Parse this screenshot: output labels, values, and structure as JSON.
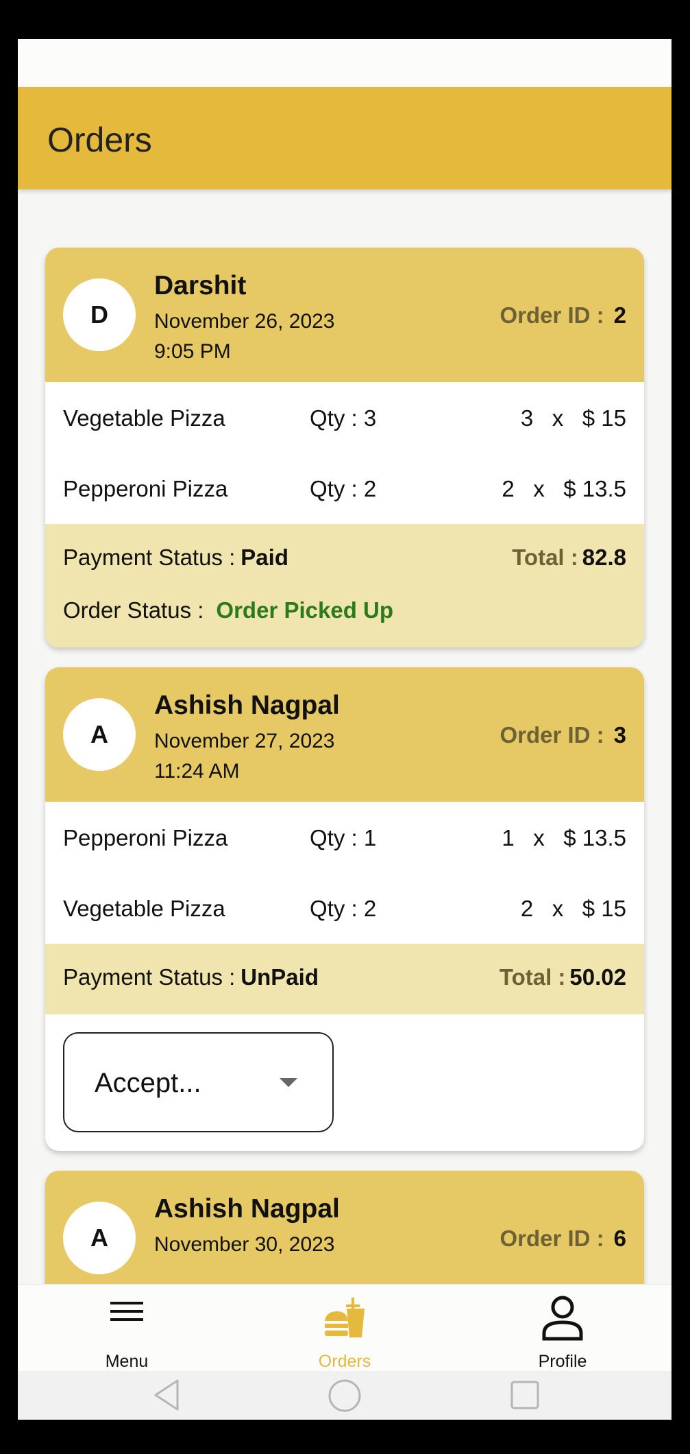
{
  "header": {
    "title": "Orders"
  },
  "orders": [
    {
      "avatar_letter": "D",
      "customer": "Darshit",
      "date": "November 26, 2023",
      "time": "9:05 PM",
      "order_id_label": "Order ID :",
      "order_id": "2",
      "items": [
        {
          "name": "Vegetable Pizza",
          "qty": "Qty : 3",
          "price": "3   x   $ 15"
        },
        {
          "name": "Pepperoni Pizza",
          "qty": "Qty : 2",
          "price": "2   x   $ 13.5"
        }
      ],
      "payment_label": "Payment Status :",
      "payment_status": "Paid",
      "total_label": "Total :",
      "total": "82.8",
      "order_status_label": "Order Status :",
      "order_status": "Order Picked Up"
    },
    {
      "avatar_letter": "A",
      "customer": "Ashish Nagpal",
      "date": "November 27, 2023",
      "time": "11:24 AM",
      "order_id_label": "Order ID :",
      "order_id": "3",
      "items": [
        {
          "name": "Pepperoni Pizza",
          "qty": "Qty : 1",
          "price": "1   x   $ 13.5"
        },
        {
          "name": "Vegetable Pizza",
          "qty": "Qty : 2",
          "price": "2   x   $ 15"
        }
      ],
      "payment_label": "Payment Status :",
      "payment_status": "UnPaid",
      "total_label": "Total :",
      "total": "50.02",
      "status_select_value": "Accept..."
    },
    {
      "avatar_letter": "A",
      "customer": "Ashish Nagpal",
      "date": "November 30, 2023",
      "order_id_label": "Order ID :",
      "order_id": "6"
    }
  ],
  "bottom_nav": [
    {
      "label": "Menu",
      "icon": "menu-icon"
    },
    {
      "label": "Orders",
      "icon": "food-orders-icon",
      "active": true
    },
    {
      "label": "Profile",
      "icon": "profile-icon"
    }
  ],
  "colors": {
    "accent": "#e4b93c",
    "card_header": "#e6c965",
    "card_footer": "#f0e5ae",
    "status_green": "#2b7a1c"
  }
}
